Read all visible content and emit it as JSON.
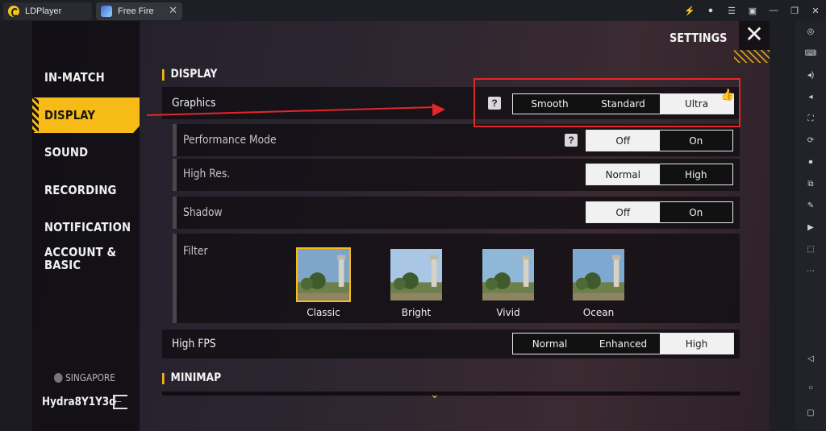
{
  "window": {
    "tabs": [
      {
        "label": "LDPlayer"
      },
      {
        "label": "Free Fire"
      }
    ]
  },
  "title_icons": [
    "bolt-icon",
    "account-icon",
    "menu-icon",
    "screen-icon",
    "minimize-icon",
    "restore-icon",
    "close-icon"
  ],
  "sidebar_icons": [
    "gamepad-icon",
    "keyboard-icon",
    "volume-up-icon",
    "volume-down-icon",
    "fullscreen-icon",
    "rotate-icon",
    "record-icon",
    "multi-instance-icon",
    "operation-icon",
    "video-icon",
    "apk-icon",
    "more-icon",
    "back-icon",
    "home-icon",
    "recent-icon"
  ],
  "nav": {
    "items": [
      "IN-MATCH",
      "DISPLAY",
      "SOUND",
      "RECORDING",
      "NOTIFICATION",
      "ACCOUNT &",
      "BASIC"
    ],
    "active": "DISPLAY"
  },
  "region": "SINGAPORE",
  "username": "Hydra8Y1Y3d",
  "header": {
    "title": "SETTINGS",
    "close": "✕"
  },
  "display": {
    "section": "DISPLAY",
    "graphics": {
      "label": "Graphics",
      "help": "?",
      "options": [
        "Smooth",
        "Standard",
        "Ultra"
      ],
      "selected": "Ultra"
    },
    "performance": {
      "label": "Performance Mode",
      "help": "?",
      "options": [
        "Off",
        "On"
      ],
      "selected": "Off"
    },
    "highres": {
      "label": "High Res.",
      "options": [
        "Normal",
        "High"
      ],
      "selected": "Normal"
    },
    "shadow": {
      "label": "Shadow",
      "options": [
        "Off",
        "On"
      ],
      "selected": "Off"
    },
    "filter": {
      "label": "Filter",
      "options": [
        "Classic",
        "Bright",
        "Vivid",
        "Ocean"
      ],
      "selected": "Classic"
    },
    "highfps": {
      "label": "High FPS",
      "options": [
        "Normal",
        "Enhanced",
        "High"
      ],
      "selected": "High"
    }
  },
  "minimap": {
    "section": "MINIMAP"
  },
  "colors": {
    "accent": "#f6bb16",
    "highlight": "#e3262b"
  }
}
